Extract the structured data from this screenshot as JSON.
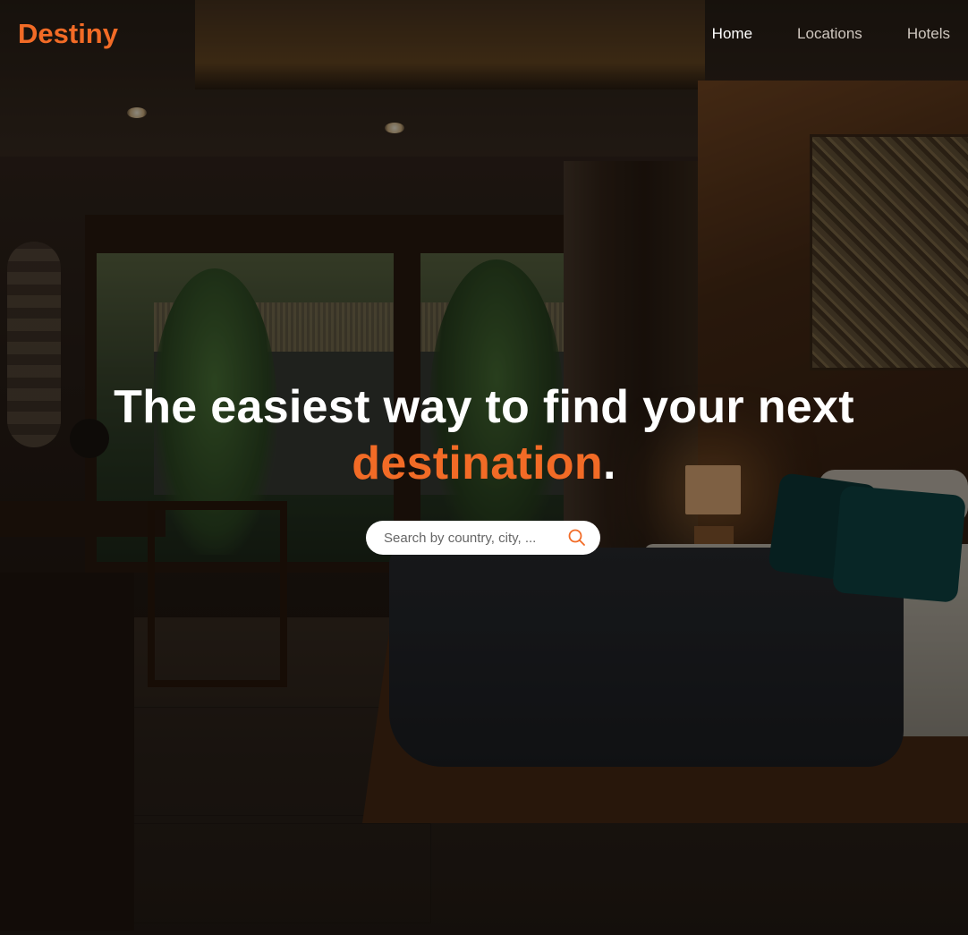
{
  "brand": {
    "name": "Destiny",
    "accent_color": "#f26b26"
  },
  "nav": {
    "items": [
      {
        "label": "Home",
        "active": true
      },
      {
        "label": "Locations",
        "active": false
      },
      {
        "label": "Hotels",
        "active": false
      }
    ]
  },
  "hero": {
    "headline_main": "The easiest way to find your next",
    "headline_accent": "destination",
    "headline_end": ".",
    "background": "hotel-bedroom-photo"
  },
  "search": {
    "placeholder": "Search by country, city, ...",
    "value": "",
    "icon": "search-icon"
  }
}
